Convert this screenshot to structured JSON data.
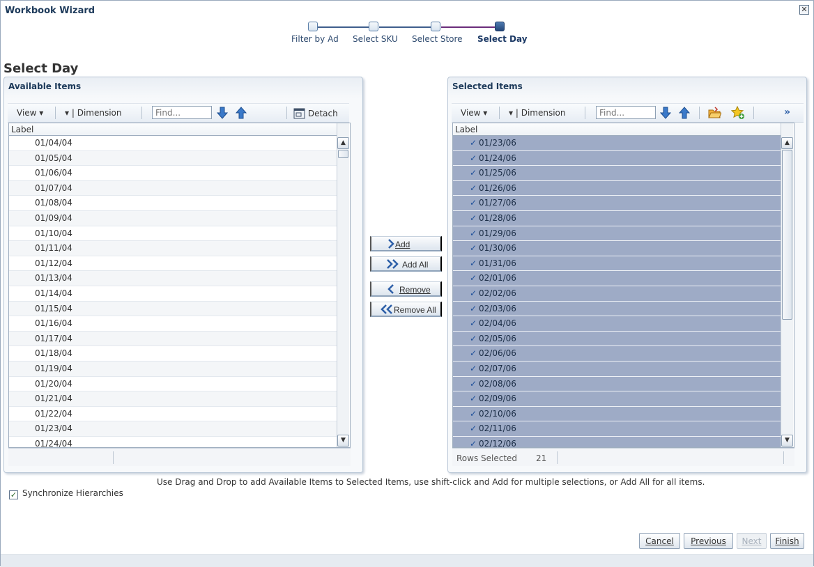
{
  "window": {
    "title": "Workbook Wizard",
    "close_glyph": "✕"
  },
  "train": {
    "stops": [
      {
        "label": "Filter by Ad",
        "state": "visited"
      },
      {
        "label": "Select SKU",
        "state": "visited"
      },
      {
        "label": "Select Store",
        "state": "visited"
      },
      {
        "label": "Select Day",
        "state": "current"
      }
    ]
  },
  "page": {
    "heading": "Select Day"
  },
  "available": {
    "title": "Available Items",
    "toolbar": {
      "view_label": "View ▾",
      "dimension_label": "Dimension",
      "find_placeholder": "Find...",
      "detach_label": "Detach"
    },
    "column_header": "Label",
    "rows": [
      "01/04/04",
      "01/05/04",
      "01/06/04",
      "01/07/04",
      "01/08/04",
      "01/09/04",
      "01/10/04",
      "01/11/04",
      "01/12/04",
      "01/13/04",
      "01/14/04",
      "01/15/04",
      "01/16/04",
      "01/17/04",
      "01/18/04",
      "01/19/04",
      "01/20/04",
      "01/21/04",
      "01/22/04",
      "01/23/04",
      "01/24/04"
    ]
  },
  "selected": {
    "title": "Selected Items",
    "toolbar": {
      "view_label": "View ▾",
      "dimension_label": "Dimension",
      "find_placeholder": "Find...",
      "more_label": "»"
    },
    "column_header": "Label",
    "rows": [
      "01/23/06",
      "01/24/06",
      "01/25/06",
      "01/26/06",
      "01/27/06",
      "01/28/06",
      "01/29/06",
      "01/30/06",
      "01/31/06",
      "02/01/06",
      "02/02/06",
      "02/03/06",
      "02/04/06",
      "02/05/06",
      "02/06/06",
      "02/07/06",
      "02/08/06",
      "02/09/06",
      "02/10/06",
      "02/11/06",
      "02/12/06"
    ],
    "status": {
      "rows_selected_label": "Rows Selected",
      "rows_selected_count": "21"
    }
  },
  "shuttle": {
    "add": "Add",
    "add_all": "Add All",
    "remove": "Remove",
    "remove_all": "Remove All"
  },
  "hint_text": "Use Drag and Drop to add Available Items to Selected Items, use shift-click and Add for multiple selections, or Add All for all items.",
  "sync": {
    "label": "Synchronize Hierarchies",
    "checked": true
  },
  "footer": {
    "cancel": "Cancel",
    "previous": "Previous",
    "next": "Next",
    "finish": "Finish"
  },
  "colors": {
    "selected_row": "#9eabc6",
    "accent": "#1d3a66",
    "visited_line": "#6a2c7a"
  }
}
